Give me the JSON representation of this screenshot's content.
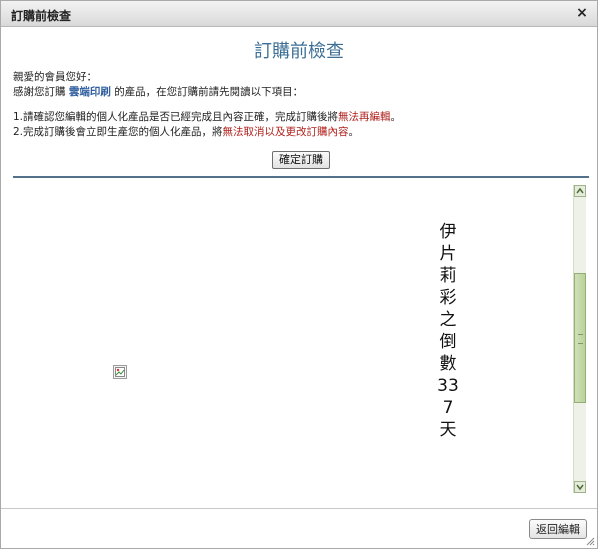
{
  "dialog": {
    "title": "訂購前檢查",
    "close_glyph": "×"
  },
  "heading": "訂購前檢查",
  "greeting": "親愛的會員您好：",
  "intro": {
    "prefix": "感謝您訂購",
    "brand": "雲端印刷",
    "suffix": "的產品，在您訂購前請先閱讀以下項目："
  },
  "items": [
    {
      "text": "1.請確認您編輯的個人化產品是否已經完成且內容正確，完成訂購後將",
      "highlight": "無法再編輯",
      "end": "。"
    },
    {
      "text": "2.完成訂購後會立即生產您的個人化產品，將",
      "highlight": "無法取消以及更改訂購內容",
      "end": "。"
    }
  ],
  "buttons": {
    "confirm": "確定訂購",
    "back": "返回編輯"
  },
  "preview": {
    "vertical_text": "伊片莉彩之倒數337天",
    "broken_image_icon": "broken-image-icon"
  },
  "colors": {
    "heading": "#3b6e96",
    "highlight": "#b0201c",
    "divider": "#54718c",
    "scroll_thumb": "#b9d39a"
  }
}
